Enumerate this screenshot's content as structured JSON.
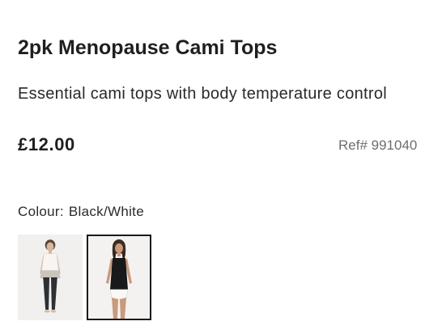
{
  "product": {
    "title": "2pk Menopause Cami Tops",
    "subtitle": "Essential cami tops with body temperature control",
    "price": "£12.00",
    "ref": "Ref# 991040"
  },
  "colour": {
    "label": "Colour:",
    "selected": "Black/White"
  },
  "swatches": [
    {
      "icon": "model-white-cami-image",
      "selected": false
    },
    {
      "icon": "model-black-cami-image",
      "selected": true
    }
  ]
}
